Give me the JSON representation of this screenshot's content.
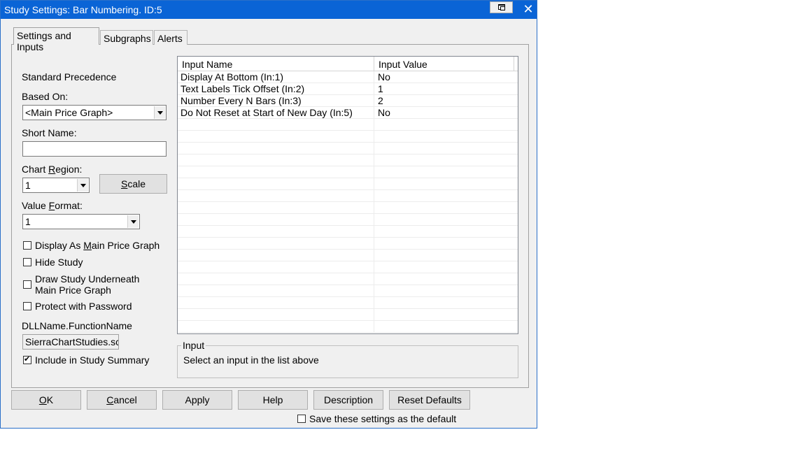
{
  "window": {
    "title": "Study Settings: Bar Numbering. ID:5",
    "close_glyph": "✕"
  },
  "tabs": [
    {
      "label": "Settings and Inputs"
    },
    {
      "label": "Subgraphs"
    },
    {
      "label": "Alerts"
    }
  ],
  "settings": {
    "standard_precedence": "Standard Precedence",
    "based_on_label": "Based On:",
    "based_on_value": "<Main Price Graph>",
    "short_name_label": "Short Name:",
    "short_name_value": "",
    "chart_region_pre": "Chart ",
    "chart_region_u": "R",
    "chart_region_post": "egion:",
    "chart_region_value": "1",
    "scale_u": "S",
    "scale_post": "cale",
    "value_format_pre": "Value ",
    "value_format_u": "F",
    "value_format_post": "ormat:",
    "value_format_value": "1",
    "display_as_main_pre": "Display As ",
    "display_as_main_u": "M",
    "display_as_main_post": "ain Price Graph",
    "display_as_main_checked": false,
    "hide_study": "Hide Study",
    "hide_study_checked": false,
    "draw_underneath_line1": "Draw Study Underneath",
    "draw_underneath_line2": "Main Price Graph",
    "draw_underneath_checked": false,
    "protect_password": "Protect with Password",
    "protect_password_checked": false,
    "dll_label": "DLLName.FunctionName",
    "dll_value": "SierraChartStudies.scsf_BarNumbering",
    "include_summary": "Include in Study Summary",
    "include_summary_checked": true
  },
  "inputs_table": {
    "columns": [
      "Input Name",
      "Input Value"
    ],
    "rows": [
      {
        "name": "Display At Bottom  (In:1)",
        "value": "No"
      },
      {
        "name": "Text Labels Tick Offset  (In:2)",
        "value": "1"
      },
      {
        "name": "Number Every N Bars  (In:3)",
        "value": "2"
      },
      {
        "name": "Do Not Reset at Start of New Day  (In:5)",
        "value": "No"
      },
      {
        "name": "",
        "value": ""
      },
      {
        "name": "",
        "value": ""
      },
      {
        "name": "",
        "value": ""
      },
      {
        "name": "",
        "value": ""
      },
      {
        "name": "",
        "value": ""
      },
      {
        "name": "",
        "value": ""
      },
      {
        "name": "",
        "value": ""
      },
      {
        "name": "",
        "value": ""
      },
      {
        "name": "",
        "value": ""
      },
      {
        "name": "",
        "value": ""
      },
      {
        "name": "",
        "value": ""
      },
      {
        "name": "",
        "value": ""
      },
      {
        "name": "",
        "value": ""
      },
      {
        "name": "",
        "value": ""
      },
      {
        "name": "",
        "value": ""
      },
      {
        "name": "",
        "value": ""
      },
      {
        "name": "",
        "value": ""
      },
      {
        "name": "",
        "value": ""
      }
    ]
  },
  "input_group": {
    "legend": "Input",
    "text": "Select an input in the list above"
  },
  "buttons": {
    "ok_u": "O",
    "ok_post": "K",
    "cancel_u": "C",
    "cancel_post": "ancel",
    "apply": "Apply",
    "help": "Help",
    "description": "Description",
    "reset_defaults": "Reset Defaults"
  },
  "save_default": {
    "label": "Save these settings as the default",
    "checked": false
  }
}
